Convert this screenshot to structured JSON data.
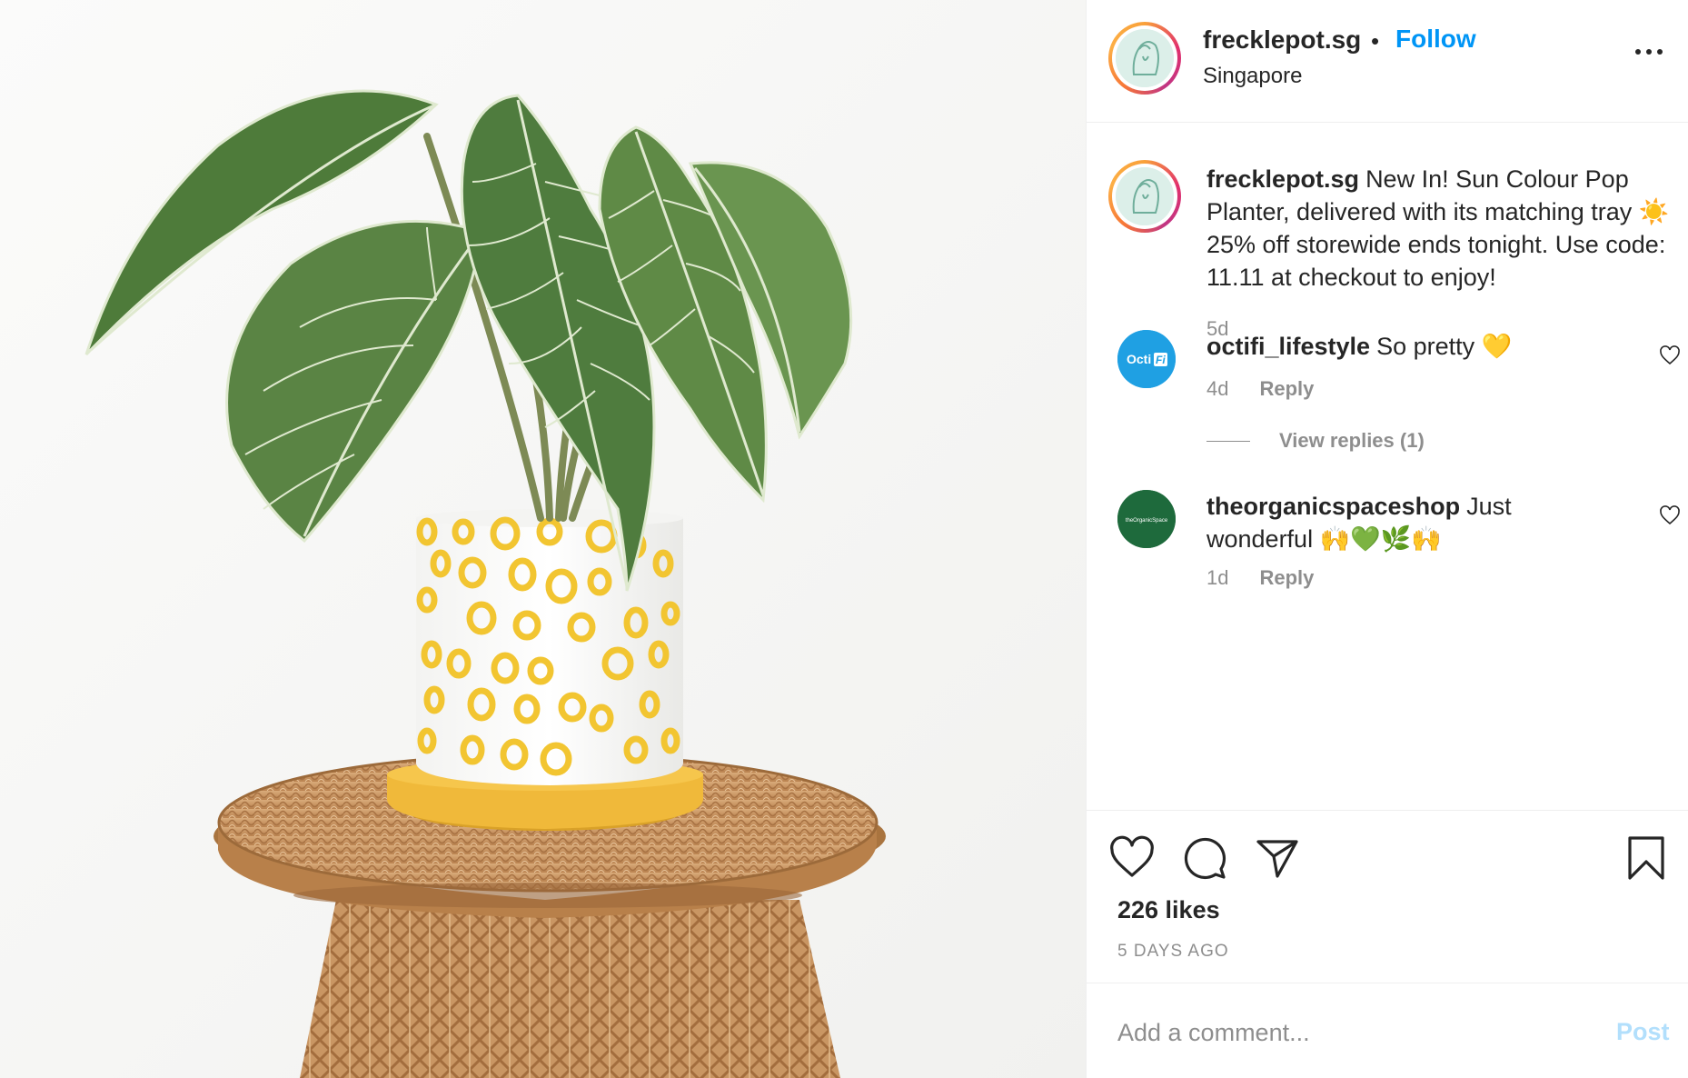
{
  "header": {
    "username": "frecklepot.sg",
    "separator": "•",
    "follow_label": "Follow",
    "location": "Singapore",
    "more_icon": "more-horizontal-icon"
  },
  "caption": {
    "username": "frecklepot.sg",
    "text_before_emoji": "New In! Sun Colour Pop Planter, delivered with its matching tray",
    "emoji": "☀️",
    "text_after_emoji": "25% off storewide ends tonight. Use code: 11.11 at checkout to enjoy!",
    "time": "5d"
  },
  "comments": [
    {
      "username": "octifi_lifestyle",
      "text": "So pretty 💛",
      "time": "4d",
      "reply_label": "Reply",
      "avatar_text": "OctiFi",
      "avatar_color": "#1fa0e3",
      "view_replies": "View replies (1)"
    },
    {
      "username": "theorganicspaceshop",
      "text": "Just wonderful 🙌💚🌿🙌",
      "time": "1d",
      "reply_label": "Reply",
      "avatar_text": "theOrganicSpace",
      "avatar_color": "#1e6a3c"
    }
  ],
  "actions": {
    "icons": [
      "heart-icon",
      "comment-icon",
      "share-icon",
      "bookmark-icon"
    ],
    "likes": "226 likes",
    "date": "5 DAYS AGO"
  },
  "add_comment": {
    "placeholder": "Add a comment...",
    "post_label": "Post"
  },
  "colors": {
    "link_blue": "#0095f6",
    "muted": "#8e8e8e",
    "post_disabled": "#b2dffc",
    "text": "#262626"
  }
}
